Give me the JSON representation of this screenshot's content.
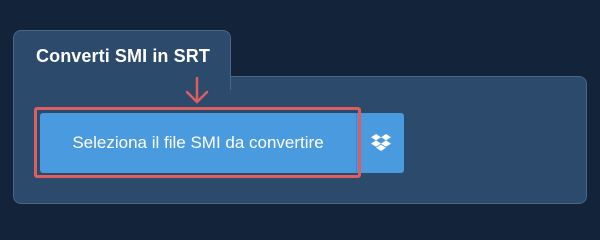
{
  "converter": {
    "tab_title": "Converti SMI in SRT",
    "select_file_label": "Seleziona il file SMI da convertire",
    "dropbox_icon": "dropbox-icon"
  },
  "colors": {
    "page_background": "#13233a",
    "panel_background": "#2c4a6b",
    "button_background": "#4a9ae0",
    "highlight": "#dc5e5e"
  }
}
